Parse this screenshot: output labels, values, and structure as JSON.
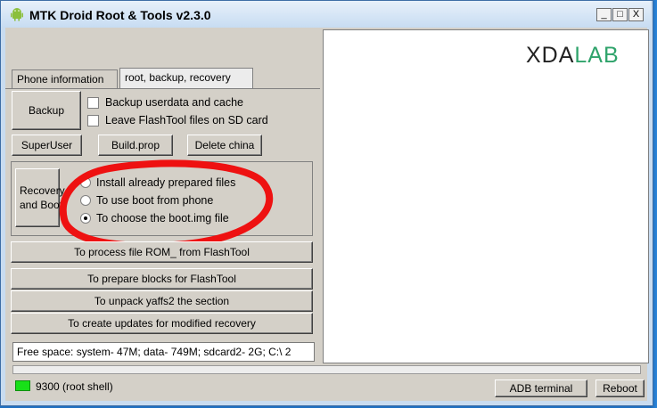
{
  "window": {
    "title": "MTK Droid Root & Tools v2.3.0",
    "controls": {
      "minimize": "_",
      "maximize": "□",
      "close": "X"
    }
  },
  "tabs": [
    {
      "label": "Phone information",
      "active": false
    },
    {
      "label": "root, backup, recovery",
      "active": true
    }
  ],
  "backup": {
    "button_label": "Backup",
    "options": [
      {
        "label": "Backup userdata and cache",
        "checked": false
      },
      {
        "label": "Leave FlashTool files on SD card",
        "checked": false
      }
    ]
  },
  "actions": {
    "superuser": "SuperUser",
    "build_prop": "Build.prop",
    "delete_china": "Delete china"
  },
  "recovery": {
    "button_label": "Recovery and Boot",
    "options": [
      {
        "label": "Install already prepared files",
        "selected": false
      },
      {
        "label": "To use boot from phone",
        "selected": false
      },
      {
        "label": "To choose the boot.img file",
        "selected": true
      }
    ]
  },
  "operations": {
    "process_rom": "To process file ROM_ from FlashTool",
    "prepare_blocks": "To prepare blocks for FlashTool",
    "unpack_yaffs2": "To unpack yaffs2 the section",
    "create_updates": "To create updates for modified recovery"
  },
  "free_space": "Free space: system- 47M; data- 749M; sdcard2- 2G;  C:\\ 2",
  "logo": {
    "part1": "XDA",
    "part2": "LAB"
  },
  "status": {
    "text": "9300 (root shell)",
    "led_color": "#18e018"
  },
  "bottom_buttons": {
    "adb_terminal": "ADB terminal",
    "reboot": "Reboot"
  },
  "accent_colors": {
    "annotation": "#ee1111",
    "title_bar": "#c7dcf2"
  }
}
